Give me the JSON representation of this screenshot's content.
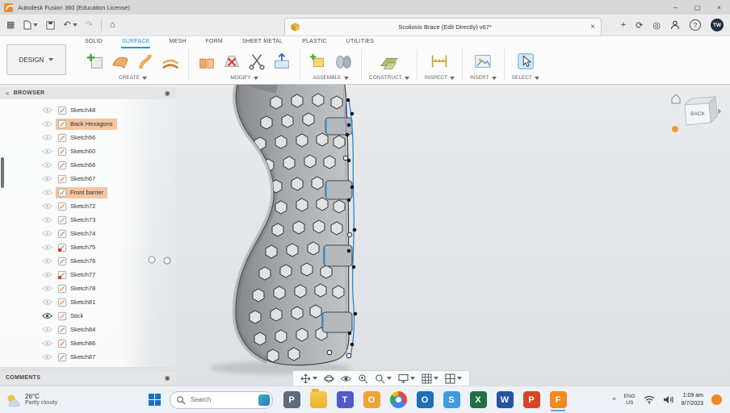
{
  "window": {
    "title": "Autodesk Fusion 360 (Education License)"
  },
  "icons": {
    "app_grid": "▦",
    "undo": "↶",
    "redo": "↷",
    "home": "⌂",
    "add_tab": "+",
    "refresh": "⟳",
    "status": "◎",
    "help": "?",
    "doc_close": "×",
    "win_min": "–",
    "win_max": "▢",
    "win_close": "×",
    "collapse": "«",
    "panel_menu": "◉",
    "chevron_up": "^"
  },
  "app_bar": {
    "doc_title": "Scoliosis Brace (Edit Directly) v67*",
    "avatar": "TW"
  },
  "ribbon": {
    "design_label": "DESIGN",
    "tabs": [
      {
        "label": "SOLID"
      },
      {
        "label": "SURFACE",
        "active": true
      },
      {
        "label": "MESH"
      },
      {
        "label": "FORM"
      },
      {
        "label": "SHEET METAL"
      },
      {
        "label": "PLASTIC"
      },
      {
        "label": "UTILITIES"
      }
    ],
    "groups": [
      {
        "label": "CREATE"
      },
      {
        "label": "MODIFY"
      },
      {
        "label": "ASSEMBLE"
      },
      {
        "label": "CONSTRUCT"
      },
      {
        "label": "INSPECT"
      },
      {
        "label": "INSERT"
      },
      {
        "label": "SELECT"
      }
    ]
  },
  "browser": {
    "header": "BROWSER",
    "comments": "COMMENTS",
    "items": [
      {
        "label": "Sketch48"
      },
      {
        "label": "Back Hexagons",
        "highlight": true
      },
      {
        "label": "Sketch56"
      },
      {
        "label": "Sketch60"
      },
      {
        "label": "Sketch66"
      },
      {
        "label": "Sketch67"
      },
      {
        "label": "Front barrier",
        "highlight": true
      },
      {
        "label": "Sketch72"
      },
      {
        "label": "Sketch73"
      },
      {
        "label": "Sketch74"
      },
      {
        "label": "Sketch75",
        "locked": true
      },
      {
        "label": "Sketch76"
      },
      {
        "label": "Sketch77",
        "locked": true
      },
      {
        "label": "Sketch78"
      },
      {
        "label": "Sketch81"
      },
      {
        "label": "Stick",
        "visible": true
      },
      {
        "label": "Sketch84"
      },
      {
        "label": "Sketch86"
      },
      {
        "label": "Sketch87"
      }
    ]
  },
  "viewport": {
    "viewcube_face": "BACK"
  },
  "taskbar": {
    "weather_temp": "26°C",
    "weather_desc": "Partly cloudy",
    "search_placeholder": "Search",
    "apps": [
      {
        "name": "photos",
        "letter": "P",
        "color": "#5d6c7b"
      },
      {
        "name": "file-explorer",
        "letter": "",
        "color": "#f3b229",
        "folder": true
      },
      {
        "name": "teams",
        "letter": "T",
        "color": "#5059c9"
      },
      {
        "name": "onedrive",
        "letter": "O",
        "color": "#f1a23c"
      },
      {
        "name": "chrome",
        "letter": "c",
        "color": "#e84335",
        "circle": true
      },
      {
        "name": "outlook",
        "letter": "O",
        "color": "#1f6fba"
      },
      {
        "name": "skype",
        "letter": "S",
        "color": "#3d9ae3"
      },
      {
        "name": "excel",
        "letter": "X",
        "color": "#1e7145"
      },
      {
        "name": "word",
        "letter": "W",
        "color": "#2455a4"
      },
      {
        "name": "powerpoint",
        "letter": "P",
        "color": "#d24726"
      },
      {
        "name": "fusion-360",
        "letter": "F",
        "color": "#f28a1e",
        "active": true
      }
    ],
    "tray": {
      "lang": "ENG",
      "region": "US",
      "time": "1:09 am",
      "date": "8/7/2023"
    }
  }
}
